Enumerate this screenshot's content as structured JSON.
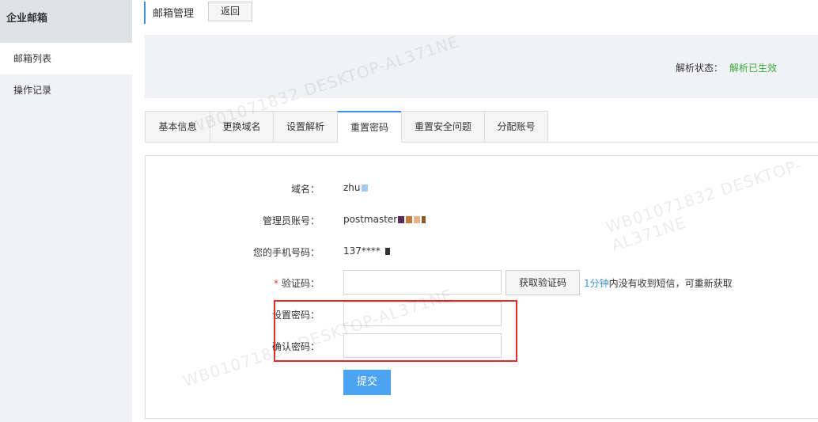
{
  "sidebar": {
    "header": "企业邮箱",
    "items": [
      {
        "label": "邮箱列表",
        "active": true
      },
      {
        "label": "操作记录",
        "active": false
      }
    ]
  },
  "topbar": {
    "title": "邮箱管理",
    "back_label": "返回"
  },
  "status": {
    "label": "解析状态：",
    "value": "解析已生效",
    "value_color": "#3aa83a"
  },
  "tabs": [
    {
      "label": "基本信息",
      "active": false
    },
    {
      "label": "更换域名",
      "active": false
    },
    {
      "label": "设置解析",
      "active": false
    },
    {
      "label": "重置密码",
      "active": true
    },
    {
      "label": "重置安全问题",
      "active": false
    },
    {
      "label": "分配账号",
      "active": false
    }
  ],
  "form": {
    "domain_label": "域名：",
    "domain_value": "zhu",
    "admin_label": "管理员账号：",
    "admin_value": "postmaster",
    "phone_label": "您的手机号码：",
    "phone_value": "137****",
    "code_label": "验证码：",
    "code_required": "*",
    "code_value": "",
    "get_code_label": "获取验证码",
    "hint_time": "1分钟",
    "hint_text": "内没有收到短信，可重新获取",
    "set_pwd_label": "设置密码：",
    "set_pwd_value": "",
    "confirm_pwd_label": "确认密码：",
    "confirm_pwd_value": "",
    "submit_label": "提交"
  },
  "watermark": "WB01071832 DESKTOP-AL371NE",
  "colors": {
    "accent": "#3d8ee0",
    "highlight": "#e22c2c",
    "submit": "#4aa3f3"
  }
}
